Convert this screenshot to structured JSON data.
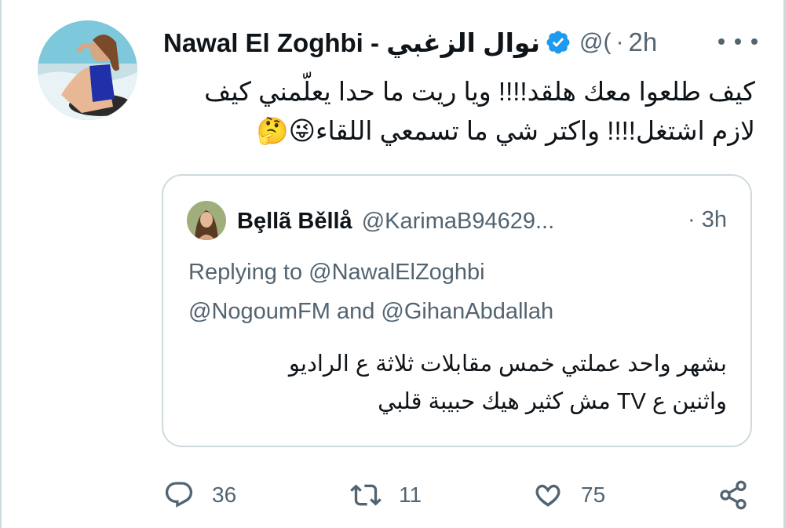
{
  "tweet": {
    "display_name": "Nawal El Zoghbi - نوال الزغبي",
    "handle_truncated": "@(",
    "separator": "·",
    "time": "2h",
    "text_lines": [
      "كيف طلعوا معك هلقد!!!! ويا ريت ما حدا يعلّمني كيف",
      "لازم اشتغل!!!! واكتر شي ما تسمعي اللقاء😜🤔"
    ]
  },
  "quoted": {
    "display_name": "Bȩllã Běllå",
    "handle": "@KarimaB94629...",
    "time": "· 3h",
    "replying_lines": [
      "Replying to @NawalElZoghbi",
      "@NogoumFM and @GihanAbdallah"
    ],
    "text_lines": [
      "بشهر واحد عملتي خمس مقابلات ثلاثة ع الراديو",
      "واثنين ع TV مش كثير هيك حبيبة قلبي"
    ]
  },
  "actions": {
    "reply_count": "36",
    "retweet_count": "11",
    "like_count": "75"
  },
  "icons": {
    "verified": "verified-badge-icon",
    "more": "more-options-icon",
    "reply": "reply-icon",
    "retweet": "retweet-icon",
    "like": "like-icon",
    "share": "share-icon"
  },
  "colors": {
    "accent": "#1d9bf0",
    "text": "#0f1419",
    "secondary": "#536471",
    "border": "#cfd9de"
  }
}
